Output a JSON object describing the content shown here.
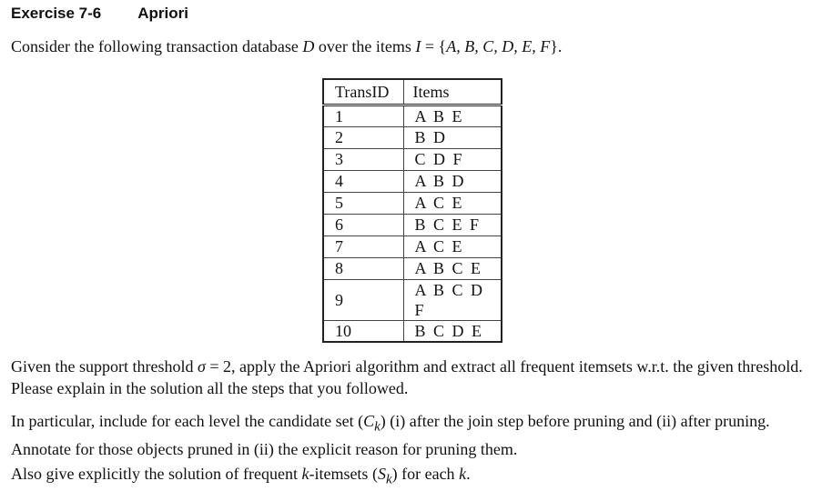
{
  "header": {
    "exercise_label": "Exercise 7-6",
    "exercise_title": "Apriori"
  },
  "intro": {
    "text_before": "Consider the following transaction database ",
    "db_symbol": "D",
    "text_middle": " over the items ",
    "items_symbol": "I",
    "equals": " = {",
    "item_set": "A, B, C, D, E, F",
    "text_after": "}."
  },
  "table": {
    "headers": [
      "TransID",
      "Items"
    ],
    "rows": [
      {
        "id": "1",
        "items": "A B E"
      },
      {
        "id": "2",
        "items": "B D"
      },
      {
        "id": "3",
        "items": "C D F"
      },
      {
        "id": "4",
        "items": "A B D"
      },
      {
        "id": "5",
        "items": "A C E"
      },
      {
        "id": "6",
        "items": "B C E F"
      },
      {
        "id": "7",
        "items": "A C E"
      },
      {
        "id": "8",
        "items": "A B C E"
      },
      {
        "id": "9",
        "items": "A B C D F"
      },
      {
        "id": "10",
        "items": "B C D E"
      }
    ]
  },
  "paragraphs": {
    "p1_before": "Given the support threshold ",
    "p1_sigma": "σ",
    "p1_after": " = 2, apply the Apriori algorithm and extract all frequent itemsets w.r.t. the given threshold. Please explain in the solution all the steps that you followed.",
    "p2_before": "In particular, include for each level the candidate set (",
    "p2_c": "C",
    "p2_k": "k",
    "p2_after": ") (i) after the join step before pruning and (ii) after pruning. Annotate for those objects pruned in (ii) the explicit reason for pruning them.",
    "p3_before": "Also give explicitly the solution of frequent ",
    "p3_k1": "k",
    "p3_mid": "-itemsets (",
    "p3_s": "S",
    "p3_k2": "k",
    "p3_mid2": ") for each ",
    "p3_k3": "k",
    "p3_end": "."
  }
}
